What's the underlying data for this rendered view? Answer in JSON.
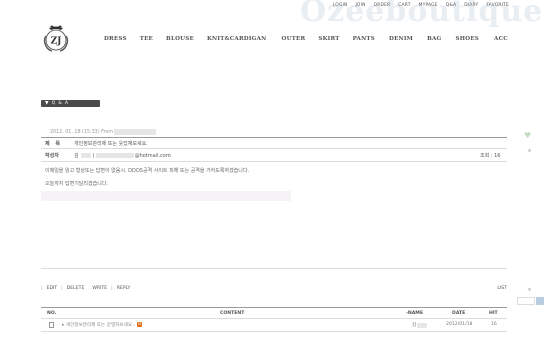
{
  "brand": {
    "watermark": "Ozeeboutique",
    "logo_text": "ZJ",
    "accent_color": "#4a4a4a"
  },
  "top_links": [
    "LOGIN",
    "JOIN",
    "ORDER",
    "CART",
    "MYPAGE",
    "Q&A",
    "DIARY",
    "FAVORITE"
  ],
  "nav": [
    "DRESS",
    "TEE",
    "BLOUSE",
    "KNIT&CARDIGAN",
    "OUTER",
    "SKIRT",
    "PANTS",
    "DENIM",
    "BAG",
    "SHOES",
    "ACC"
  ],
  "board": {
    "badge": "▼ Q & A",
    "date_line": "2012. 01. 18 (15:33) From"
  },
  "post": {
    "subject_label": "제 목",
    "subject_value": "개인정보관리제 또는 웃었재보세요.",
    "author_label": "작성자",
    "author_name": "김",
    "author_email": "@hotmail.com",
    "views_label": "조회 : 16",
    "body_line1": "이메일을 읽고 형상또는 답변이 없음시. DDOS공격 사이트 피해 또는 공격을 가하도록하겠습니다.",
    "body_line2": "오늘까지 답변기달리겠습니다."
  },
  "actions": [
    "EDIT",
    "DELETE",
    "WRITE",
    "REPLY"
  ],
  "list_label": "LIST",
  "table": {
    "headers": {
      "no": "NO.",
      "content": "CONTENT",
      "name": "NAME",
      "date": "DATE",
      "hit": "HIT"
    },
    "rows": [
      {
        "title": "▸ 개인정보관리제 또는 운영자보세요..",
        "name": "김",
        "date": "2012/01/18",
        "hit": "16",
        "new_icon": "icon-new"
      }
    ]
  },
  "side": {
    "heart_icon": "heart-icon",
    "up_icon": "arrow-up-icon",
    "down_icon": "arrow-down-icon"
  }
}
